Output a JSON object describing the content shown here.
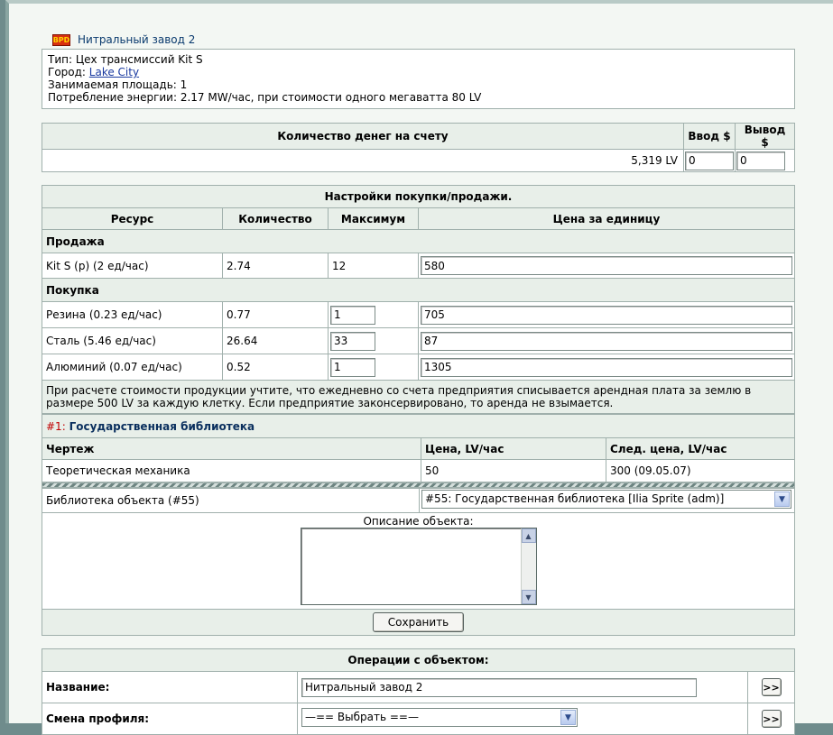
{
  "header": {
    "icon_text": "BPD",
    "title": "Нитральный завод 2",
    "type_line": "Тип: Цех трансмиссий Kit S",
    "city_label": "Город: ",
    "city_link": "Lake City",
    "area_line": "Занимаемая площадь: 1",
    "energy_line": "Потребление энергии: 2.17 MW/час, при стоимости одного мегаватта 80 LV"
  },
  "money": {
    "col_amount": "Количество денег на счету",
    "col_in": "Ввод $",
    "col_out": "Вывод $",
    "amount": "5,319 LV",
    "in_value": "0",
    "out_value": "0"
  },
  "trade": {
    "title": "Настройки покупки/продажи.",
    "col_resource": "Ресурс",
    "col_qty": "Количество",
    "col_max": "Максимум",
    "col_price": "Цена за единицу",
    "sell_section": "Продажа",
    "sell": [
      {
        "name": "Kit S (p) (2 ед/час)",
        "qty": "2.74",
        "max": "12",
        "price": "580"
      }
    ],
    "buy_section": "Покупка",
    "buy": [
      {
        "name": "Резина (0.23 ед/час)",
        "qty": "0.77",
        "max": "1",
        "price": "705"
      },
      {
        "name": "Сталь (5.46 ед/час)",
        "qty": "26.64",
        "max": "33",
        "price": "87"
      },
      {
        "name": "Алюминий (0.07 ед/час)",
        "qty": "0.52",
        "max": "1",
        "price": "1305"
      }
    ],
    "note": "При расчете стоимости продукции учтите, что ежедневно со счета предприятия списывается арендная плата за землю в размере 500 LV за каждую клетку. Если предприятие законсервировано, то аренда не взымается."
  },
  "library": {
    "rank": "#1:",
    "name": "Государственная библиотека",
    "col_blueprint": "Чертеж",
    "col_price": "Цена, LV/час",
    "col_next": "След. цена, LV/час",
    "row": {
      "blueprint": "Теоретическая механика",
      "price": "50",
      "next": "300 (09.05.07)"
    },
    "object_label": "Библиотека объекта (#55)",
    "object_select": "#55: Государственная библиотека [Ilia Sprite (adm)]",
    "desc_label": "Описание объекта:",
    "desc_value": "",
    "save_label": "Сохранить"
  },
  "ops": {
    "title": "Операции с объектом:",
    "name_label": "Название:",
    "name_value": "Нитральный завод 2",
    "go_label": ">>",
    "profile_label": "Смена профиля:",
    "profile_select": "—== Выбрать ==—"
  },
  "colors": {
    "accent_red": "#c00000",
    "title_blue": "#0a3a6e",
    "header_bg": "#e8efe9",
    "border": "#a0b0ac"
  }
}
